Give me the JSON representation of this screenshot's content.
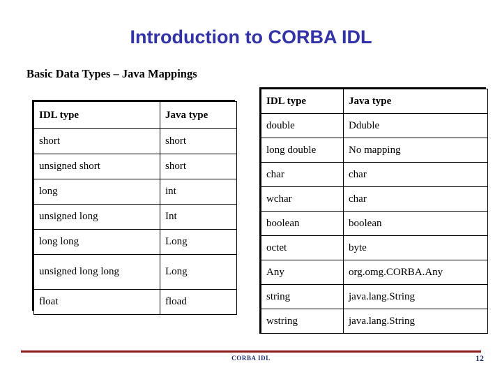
{
  "slide": {
    "title": "Introduction to CORBA IDL",
    "subtitle": "Basic Data Types – Java Mappings",
    "title_color": "#3333A8",
    "footer_rule_color": "#8B1A1A",
    "footer_text_color": "#1F2F6E"
  },
  "left_table": {
    "name": "basic-data-types-left",
    "columns": [
      "IDL type",
      "Java type"
    ],
    "rows": [
      [
        "short",
        "short"
      ],
      [
        "unsigned short",
        "short"
      ],
      [
        "long",
        "int"
      ],
      [
        "unsigned long",
        "Int"
      ],
      [
        "long long",
        "Long"
      ],
      [
        "unsigned long long",
        "Long"
      ],
      [
        "float",
        "fload"
      ]
    ]
  },
  "right_table": {
    "name": "basic-data-types-right",
    "columns": [
      "IDL type",
      "Java type"
    ],
    "rows": [
      [
        "double",
        "Dduble"
      ],
      [
        "long double",
        "No mapping"
      ],
      [
        "char",
        "char"
      ],
      [
        "wchar",
        "char"
      ],
      [
        "boolean",
        "boolean"
      ],
      [
        "octet",
        "byte"
      ],
      [
        "Any",
        "org.omg.CORBA.Any"
      ],
      [
        "string",
        "java.lang.String"
      ],
      [
        "wstring",
        "java.lang.String"
      ]
    ]
  },
  "footer": {
    "label": "CORBA IDL",
    "page_number": "12"
  }
}
